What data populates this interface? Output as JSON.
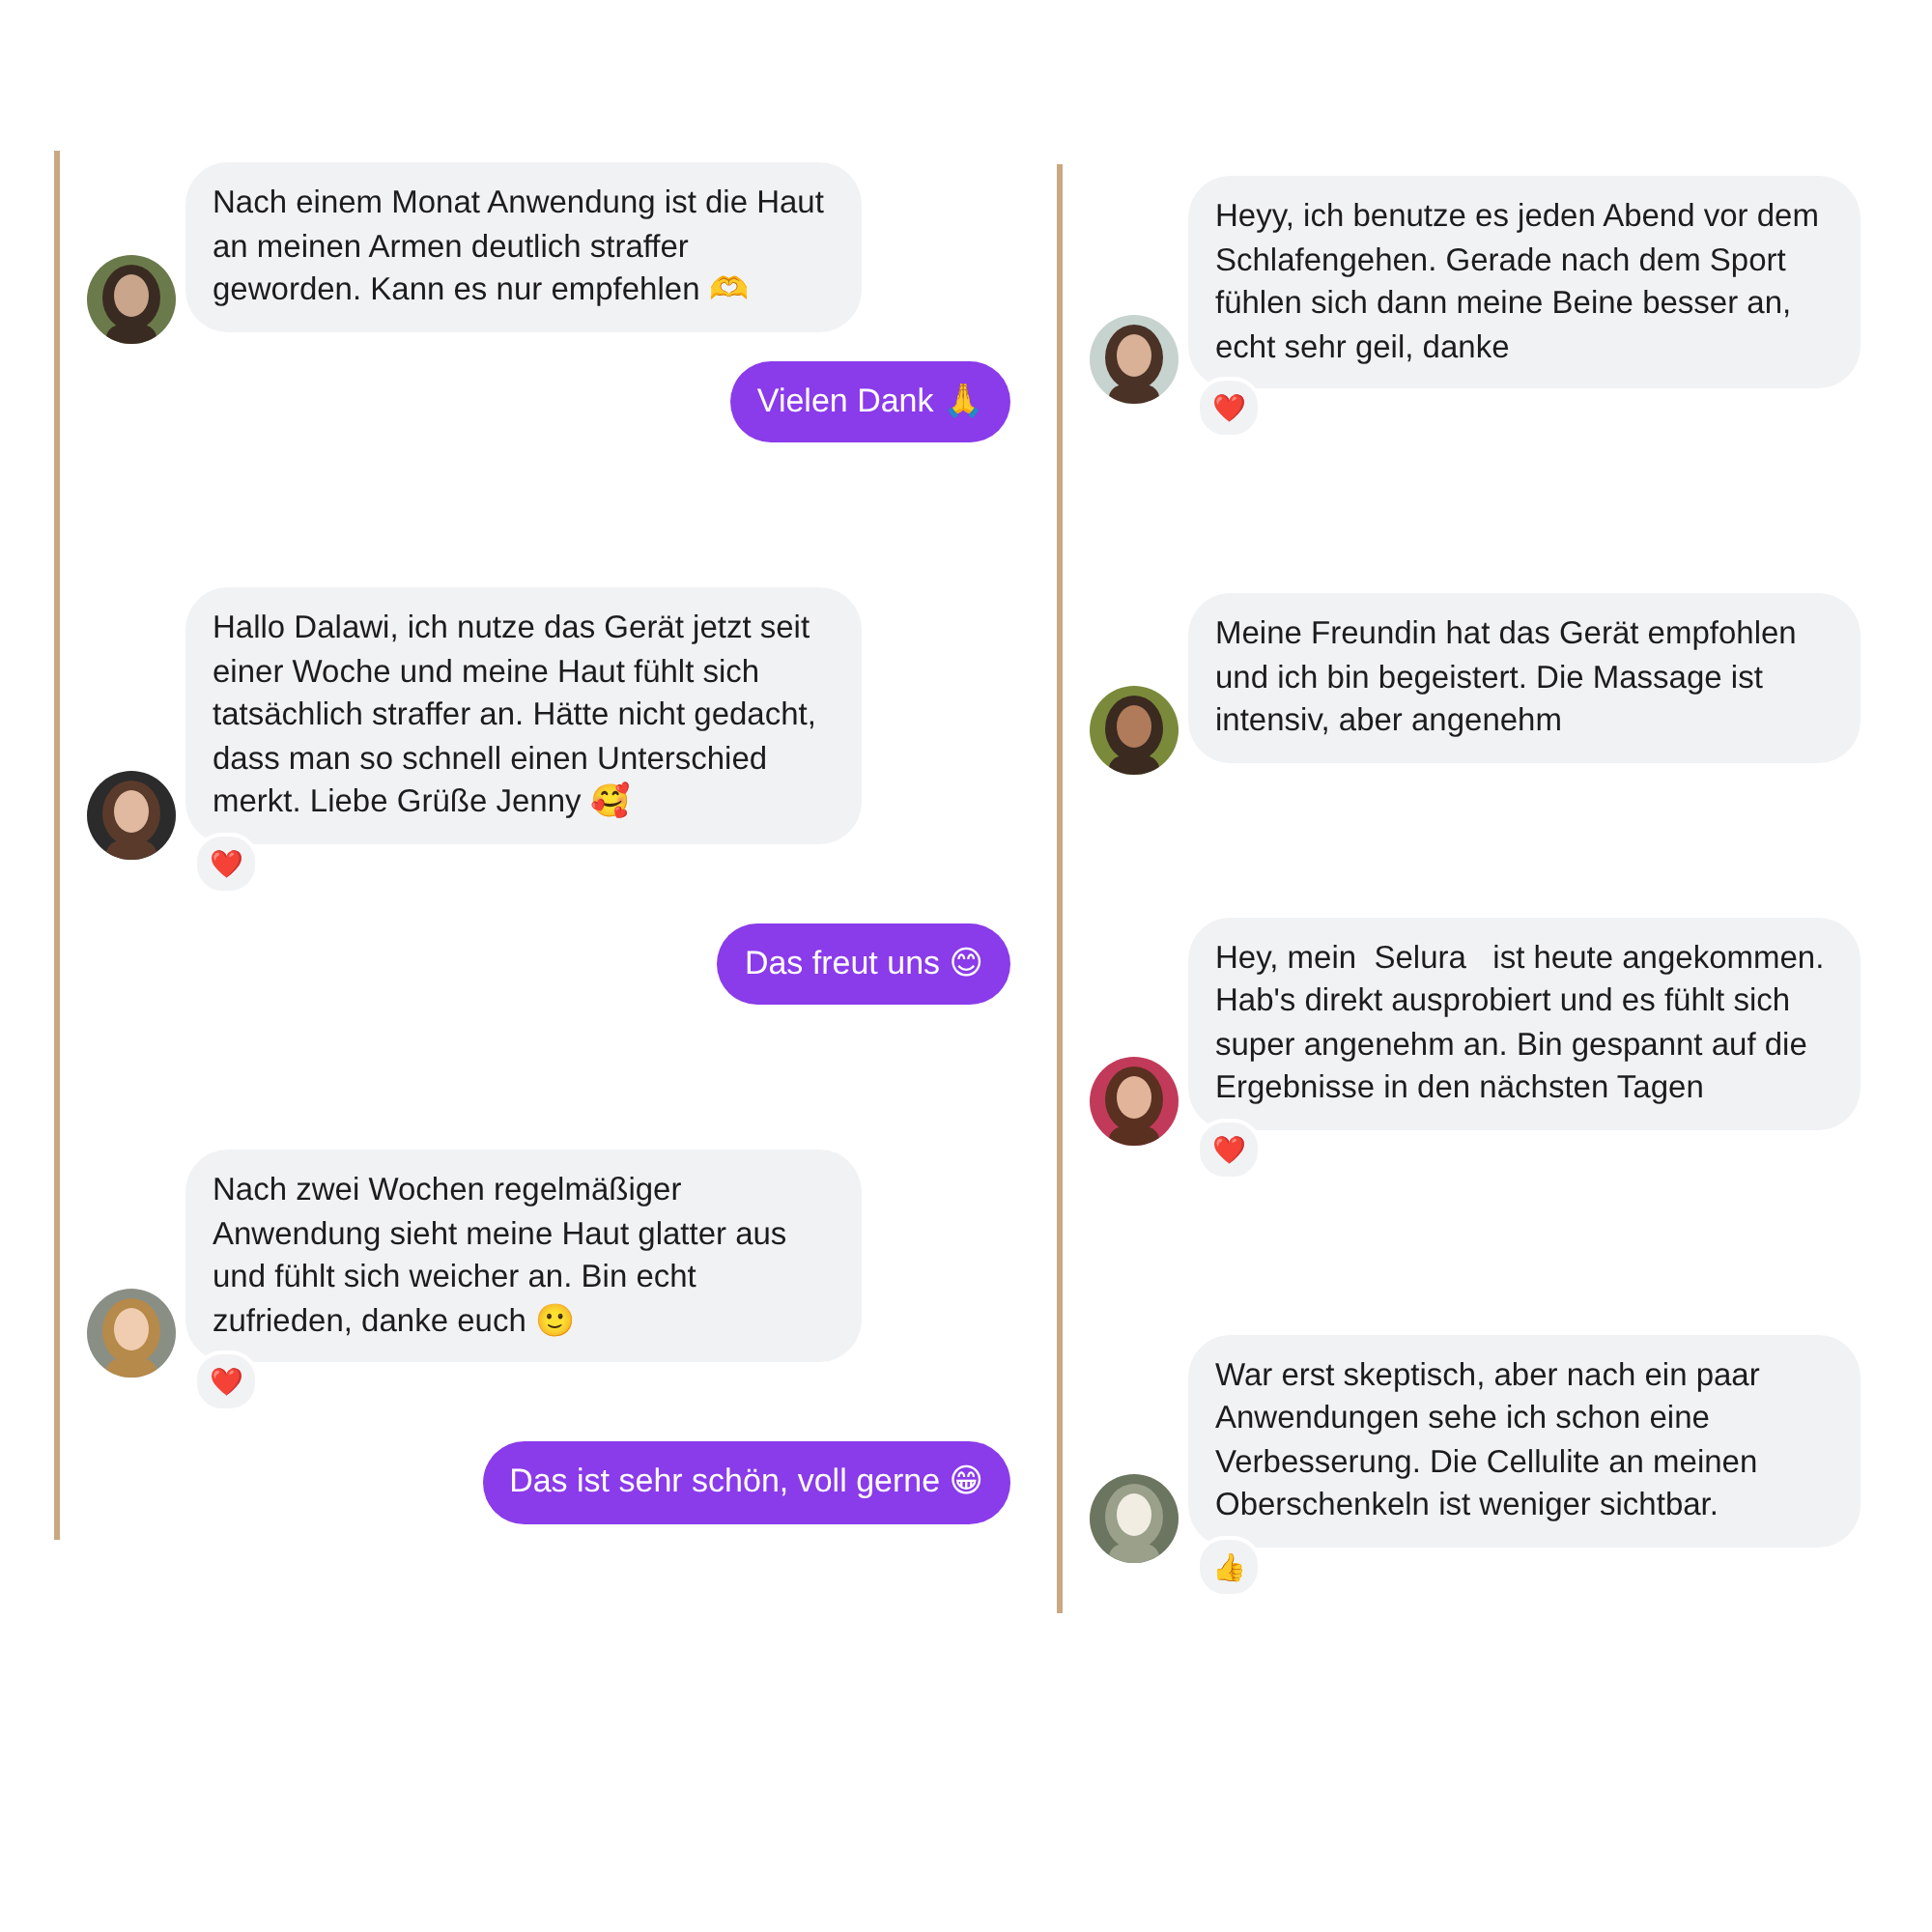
{
  "columns": [
    {
      "messages": [
        {
          "kind": "incoming",
          "text": "Nach einem Monat Anwendung ist die Haut an meinen Armen deutlich straffer geworden. Kann es nur empfehlen 🫶"
        },
        {
          "kind": "outgoing",
          "text": "Vielen Dank 🙏"
        },
        {
          "kind": "incoming",
          "text": "Hallo Dalawi, ich nutze das Gerät jetzt seit einer Woche und meine Haut fühlt sich tatsächlich straffer an. Hätte nicht gedacht, dass man so schnell einen Unterschied merkt. Liebe Grüße Jenny 🥰",
          "reaction": "❤️"
        },
        {
          "kind": "outgoing",
          "text": "Das freut uns 😊"
        },
        {
          "kind": "incoming",
          "text": "Nach zwei Wochen regelmäßiger Anwendung sieht meine Haut glatter aus und fühlt sich weicher an. Bin echt zufrieden, danke euch 🙂",
          "reaction": "❤️"
        },
        {
          "kind": "outgoing",
          "text": "Das ist sehr schön, voll gerne 😁"
        }
      ]
    },
    {
      "messages": [
        {
          "kind": "incoming",
          "text": "Heyy, ich benutze es jeden Abend vor dem Schlafengehen. Gerade nach dem Sport fühlen sich dann meine Beine besser an, echt sehr geil, danke",
          "reaction": "❤️"
        },
        {
          "kind": "incoming",
          "text": "Meine Freundin hat das Gerät empfohlen und ich bin begeistert. Die Massage ist intensiv, aber angenehm"
        },
        {
          "kind": "incoming",
          "text": "Hey, mein  Selura   ist heute angekommen. Hab's direkt ausprobiert und es fühlt sich super angenehm an. Bin gespannt auf die Ergebnisse in den nächsten Tagen",
          "reaction": "❤️"
        },
        {
          "kind": "incoming",
          "text": "War erst skeptisch, aber nach ein paar Anwendungen sehe ich schon eine Verbesserung. Die Cellulite an meinen Oberschenkeln ist weniger sichtbar.",
          "reaction": "👍"
        }
      ]
    }
  ]
}
